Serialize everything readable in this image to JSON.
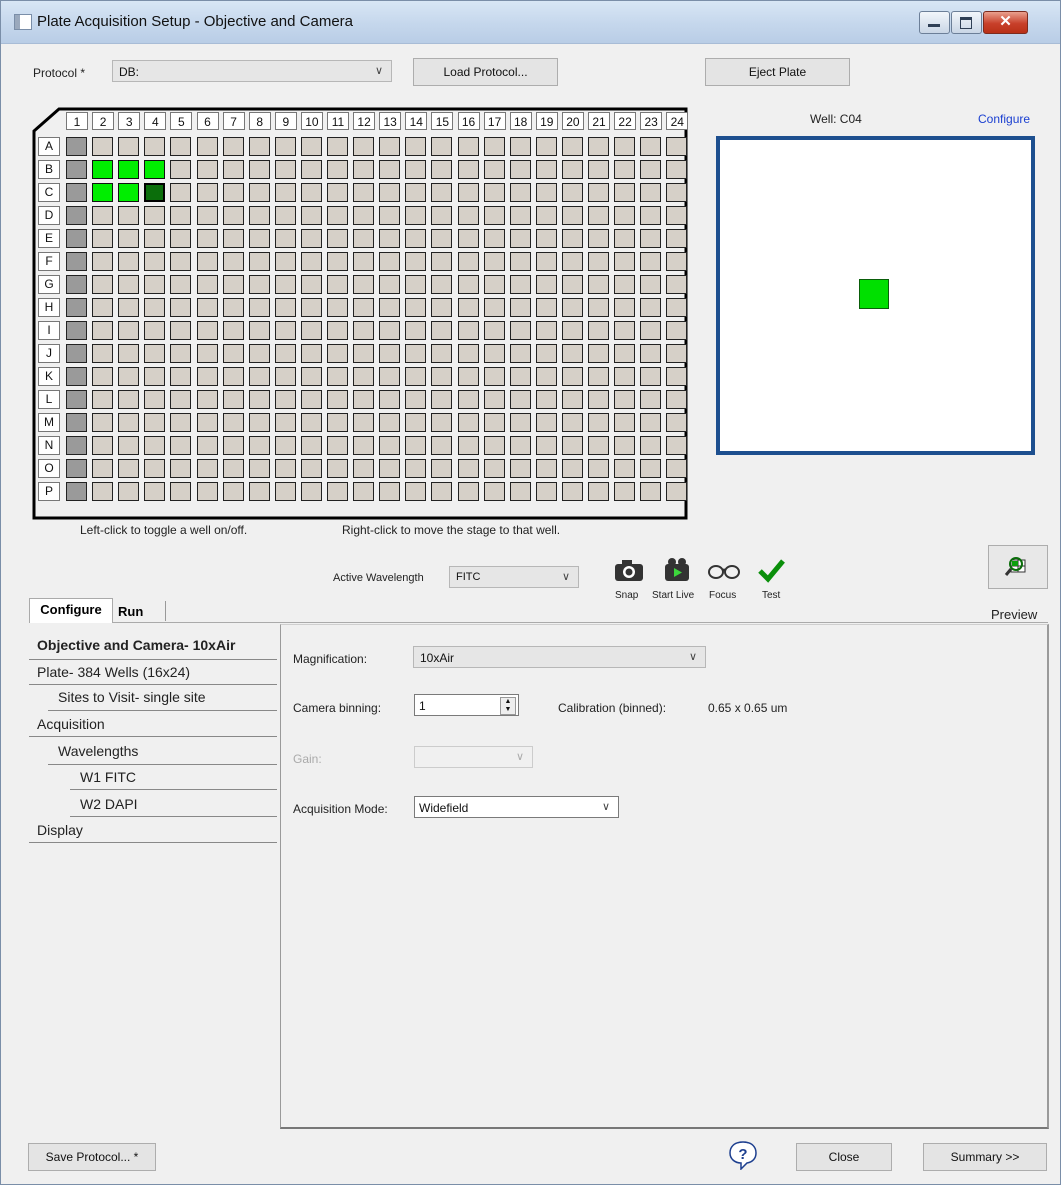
{
  "window": {
    "title": "Plate Acquisition Setup - Objective and Camera",
    "close_glyph": "✕"
  },
  "top": {
    "protocol_label": "Protocol *",
    "protocol_value": "DB:",
    "load_protocol": "Load Protocol...",
    "eject_plate": "Eject Plate"
  },
  "plate": {
    "columns": [
      "1",
      "2",
      "3",
      "4",
      "5",
      "6",
      "7",
      "8",
      "9",
      "10",
      "11",
      "12",
      "13",
      "14",
      "15",
      "16",
      "17",
      "18",
      "19",
      "20",
      "21",
      "22",
      "23",
      "24"
    ],
    "rows": [
      "A",
      "B",
      "C",
      "D",
      "E",
      "F",
      "G",
      "H",
      "I",
      "J",
      "K",
      "L",
      "M",
      "N",
      "O",
      "P"
    ],
    "enabled_wells": [
      "B2",
      "B3",
      "B4",
      "C2",
      "C3"
    ],
    "selected_well": "C4",
    "hint_left": "Left-click to toggle a well on/off.",
    "hint_right": "Right-click to move the stage to that well."
  },
  "well_view": {
    "well_label": "Well: C04",
    "configure_link": "Configure"
  },
  "toolbar": {
    "active_wavelength_label": "Active Wavelength",
    "active_wavelength_value": "FITC",
    "snap": "Snap",
    "start_live": "Start Live",
    "focus": "Focus",
    "test": "Test",
    "preview": "Preview"
  },
  "tabs": {
    "configure": "Configure",
    "run": "Run"
  },
  "nav": {
    "items": [
      "Objective and Camera- 10xAir",
      "Plate- 384 Wells (16x24)",
      "Sites to Visit- single site",
      "Acquisition",
      "Wavelengths",
      "W1 FITC",
      "W2 DAPI",
      "Display"
    ]
  },
  "settings": {
    "magnification_label": "Magnification:",
    "magnification_value": "10xAir",
    "binning_label": "Camera binning:",
    "binning_value": "1",
    "calibration_label": "Calibration (binned):",
    "calibration_value": "0.65 x 0.65 um",
    "gain_label": "Gain:",
    "acq_mode_label": "Acquisition Mode:",
    "acq_mode_value": "Widefield"
  },
  "footer": {
    "save_protocol": "Save Protocol... *",
    "close": "Close",
    "summary": "Summary >>",
    "help_glyph": "?"
  }
}
